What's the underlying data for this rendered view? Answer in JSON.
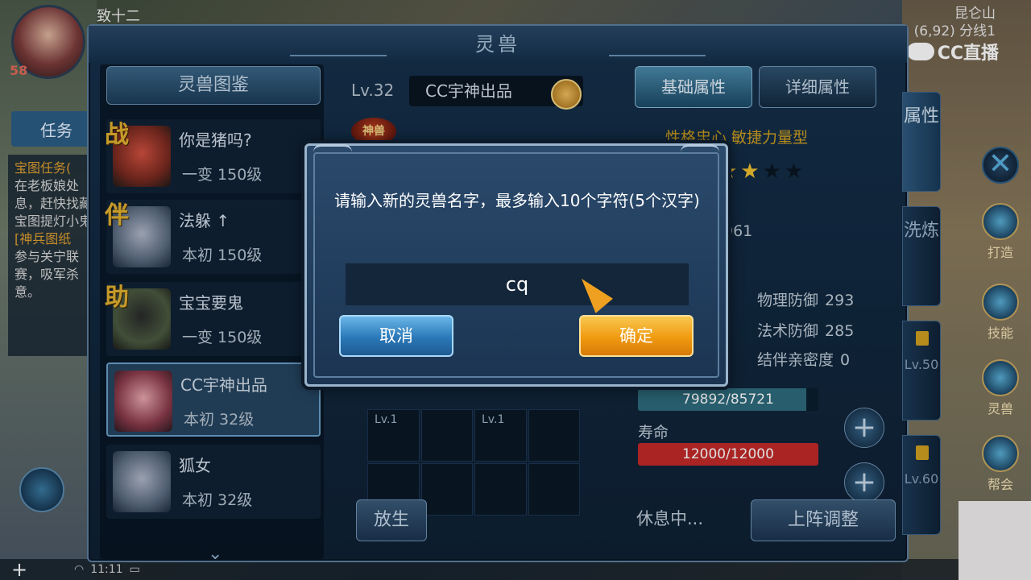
{
  "hud": {
    "player_name": "致十二",
    "player_level": "58",
    "location_name": "昆仑山",
    "location_coords": "(6,92) 分线1",
    "watermark": "CC直播",
    "task_tab": "任务",
    "tasks": [
      {
        "title": "宝图任务(",
        "desc": "在老板娘处息，赶快找藏宝图提灯小鬼"
      },
      {
        "title": "[神兵图纸",
        "desc": "参与关宁联赛，吸军杀意。"
      }
    ],
    "side_buttons": [
      "打造",
      "技能",
      "灵兽",
      "帮会"
    ],
    "bottom_time": "11:11"
  },
  "window": {
    "title": "灵兽",
    "encyclopedia_label": "灵兽图鉴",
    "pets": [
      {
        "tag": "战",
        "name": "你是猪吗?",
        "level": "一变 150级"
      },
      {
        "tag": "伴",
        "name": "法躲 ↑",
        "level": "本初 150级"
      },
      {
        "tag": "助",
        "name": "宝宝要鬼",
        "level": "一变 150级"
      },
      {
        "tag": "",
        "name": "CC宇神出品",
        "level": "本初 32级"
      },
      {
        "tag": "",
        "name": "狐女",
        "level": "本初 32级"
      }
    ],
    "selected_pet": {
      "level": "Lv.32",
      "name": "CC宇神出品",
      "badge": "神兽",
      "skill_levels": [
        "Lv.1",
        "Lv.1"
      ]
    },
    "release_label": "放生",
    "tabs": {
      "basic": "基础属性",
      "detail": "详细属性"
    },
    "personality": "性格忠心 敏捷力量型",
    "rating": {
      "filled": 2,
      "total": 4
    },
    "hp_value": "961",
    "stats": [
      {
        "label": "物理防御",
        "value": "293"
      },
      {
        "label": "法术防御",
        "value": "285"
      },
      {
        "label": "结伴亲密度",
        "value": "0"
      }
    ],
    "experience": {
      "text": "79892/85721",
      "fraction": 0.932
    },
    "life_label": "寿命",
    "life": {
      "text": "12000/12000",
      "fraction": 1.0
    },
    "status": "休息中...",
    "deploy_label": "上阵调整",
    "vertical_tabs": [
      {
        "label": "属性",
        "locked": false
      },
      {
        "label": "洗炼",
        "locked": false
      },
      {
        "label": "Lv.50",
        "locked": true
      },
      {
        "label": "Lv.60",
        "locked": true
      }
    ]
  },
  "dialog": {
    "message": "请输入新的灵兽名字，最多输入10个字符(5个汉字)",
    "input_value": "cq",
    "cancel_label": "取消",
    "confirm_label": "确定"
  }
}
